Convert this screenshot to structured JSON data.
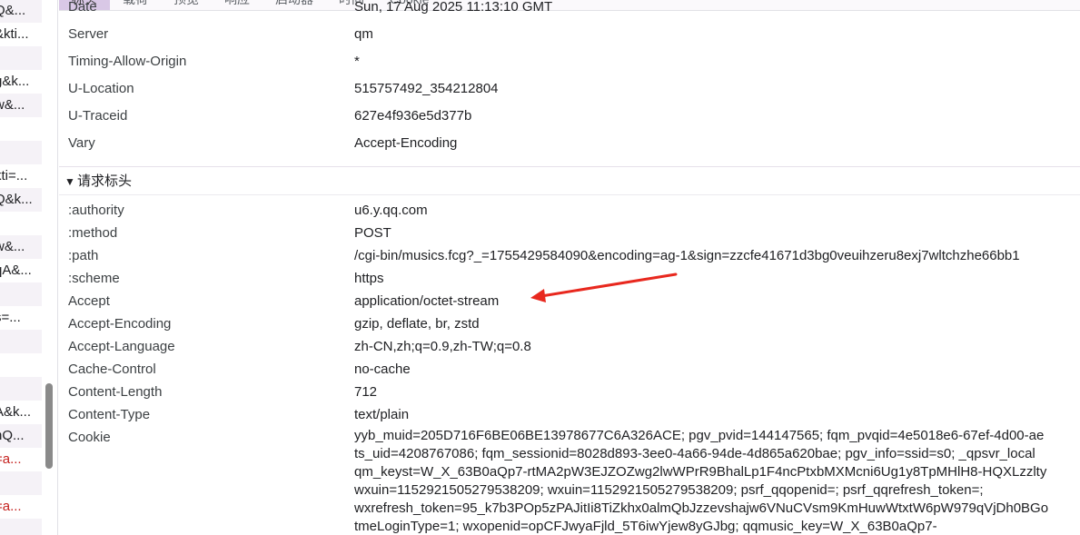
{
  "request_list": [
    {
      "text": "Q&..."
    },
    {
      "text": "&kti..."
    },
    {
      "text": ""
    },
    {
      "text": "g&k..."
    },
    {
      "text": "w&..."
    },
    {
      "text": ""
    },
    {
      "text": ""
    },
    {
      "text": "kti=..."
    },
    {
      "text": "Q&k..."
    },
    {
      "text": ""
    },
    {
      "text": "w&..."
    },
    {
      "text": "qA&..."
    },
    {
      "text": ""
    },
    {
      "text": "s=..."
    },
    {
      "text": ""
    },
    {
      "text": ""
    },
    {
      "text": ""
    },
    {
      "text": "A&k..."
    },
    {
      "text": "nQ..."
    },
    {
      "text": "=a..."
    },
    {
      "text": ""
    },
    {
      "text": "=a..."
    },
    {
      "text": ""
    }
  ],
  "tabs": [
    {
      "label": "标头"
    },
    {
      "label": "载荷"
    },
    {
      "label": "预览"
    },
    {
      "label": "响应"
    },
    {
      "label": "启动器"
    },
    {
      "label": "时间"
    },
    {
      "label": "Cookie"
    }
  ],
  "response_headers": [
    {
      "name": "Date",
      "value": "Sun, 17 Aug 2025 11:13:10 GMT"
    },
    {
      "name": "Server",
      "value": "qm"
    },
    {
      "name": "Timing-Allow-Origin",
      "value": "*"
    },
    {
      "name": "U-Location",
      "value": "515757492_354212804"
    },
    {
      "name": "U-Traceid",
      "value": "627e4f936e5d377b"
    },
    {
      "name": "Vary",
      "value": "Accept-Encoding"
    }
  ],
  "request_section": {
    "toggle": "▼",
    "title": "请求标头"
  },
  "request_headers": [
    {
      "name": ":authority",
      "value": "u6.y.qq.com"
    },
    {
      "name": ":method",
      "value": "POST"
    },
    {
      "name": ":path",
      "value": "/cgi-bin/musics.fcg?_=1755429584090&encoding=ag-1&sign=zzcfe41671d3bg0veuihzeru8exj7wltchzhe66bb1"
    },
    {
      "name": ":scheme",
      "value": "https"
    },
    {
      "name": "Accept",
      "value": "application/octet-stream"
    },
    {
      "name": "Accept-Encoding",
      "value": "gzip, deflate, br, zstd"
    },
    {
      "name": "Accept-Language",
      "value": "zh-CN,zh;q=0.9,zh-TW;q=0.8"
    },
    {
      "name": "Cache-Control",
      "value": "no-cache"
    },
    {
      "name": "Content-Length",
      "value": "712"
    },
    {
      "name": "Content-Type",
      "value": "text/plain"
    }
  ],
  "cookie": {
    "name": "Cookie",
    "lines": [
      "yyb_muid=205D716F6BE06BE13978677C6A326ACE; pgv_pvid=144147565; fqm_pvqid=4e5018e6-67ef-4d00-ae",
      "ts_uid=4208767086; fqm_sessionid=8028d893-3ee0-4a66-94de-4d865a620bae; pgv_info=ssid=s0; _qpsvr_local",
      "qm_keyst=W_X_63B0aQp7-rtMA2pW3EJZOZwg2lwWPrR9BhalLp1F4ncPtxbMXMcni6Ug1y8TpMHlH8-HQXLzzlty",
      "wxuin=1152921505279538209; wxuin=1152921505279538209; psrf_qqopenid=; psrf_qqrefresh_token=;",
      "wxrefresh_token=95_k7b3POp5zPAJitIi8TiZkhx0almQbJzzevshajw6VNuCVsm9KmHuwWtxtW6pW979qVjDh0BGo",
      "tmeLoginType=1; wxopenid=opCFJwyaFjld_5T6iwYjew8yGJbg; qqmusic_key=W_X_63B0aQp7-"
    ]
  },
  "colors": {
    "annotation_arrow": "#e8281e",
    "active_tab": "#d9c8e6",
    "error_text": "#c5221f"
  }
}
